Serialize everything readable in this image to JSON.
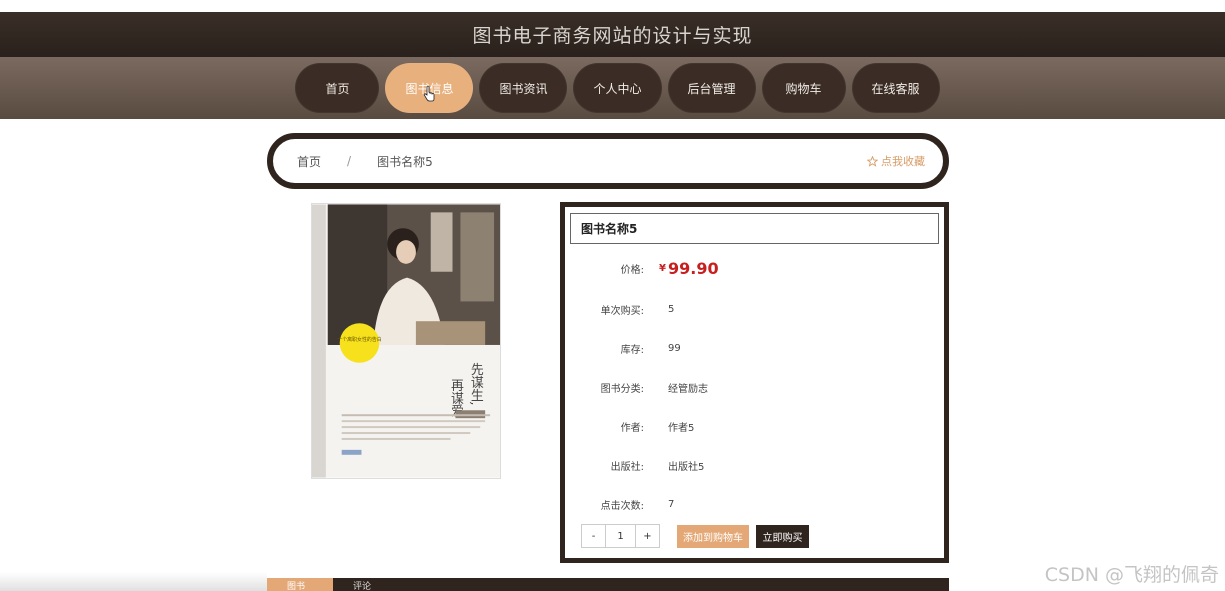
{
  "header": {
    "site_title": "图书电子商务网站的设计与实现"
  },
  "nav": {
    "items": [
      {
        "label": "首页",
        "active": false
      },
      {
        "label": "图书信息",
        "active": true
      },
      {
        "label": "图书资讯",
        "active": false
      },
      {
        "label": "个人中心",
        "active": false
      },
      {
        "label": "后台管理",
        "active": false
      },
      {
        "label": "购物车",
        "active": false
      },
      {
        "label": "在线客服",
        "active": false
      }
    ]
  },
  "breadcrumb": {
    "home": "首页",
    "separator": "/",
    "current": "图书名称5",
    "favorite": "点我收藏"
  },
  "book": {
    "title": "图书名称5",
    "price_label": "价格:",
    "price_currency": "¥",
    "price_value": "99.90",
    "fields": [
      {
        "label": "单次购买:",
        "value": "5"
      },
      {
        "label": "库存:",
        "value": "99"
      },
      {
        "label": "图书分类:",
        "value": "经管励志"
      },
      {
        "label": "作者:",
        "value": "作者5"
      },
      {
        "label": "出版社:",
        "value": "出版社5"
      },
      {
        "label": "点击次数:",
        "value": "7"
      }
    ],
    "quantity": "1",
    "minus_label": "-",
    "plus_label": "+",
    "add_to_cart": "添加到购物车",
    "buy_now": "立即购买"
  },
  "cover": {
    "title_line1": "先谋生,",
    "title_line2": "再谋爱",
    "badge": "一个离职女性的告白"
  },
  "tabs": [
    {
      "label": "图书简介",
      "active": true
    },
    {
      "label": "评论",
      "active": false
    }
  ],
  "watermark": "CSDN @飞翔的佩奇",
  "colors": {
    "dark_brown": "#2f241e",
    "accent": "#e4a876",
    "price_red": "#c81e1e"
  }
}
